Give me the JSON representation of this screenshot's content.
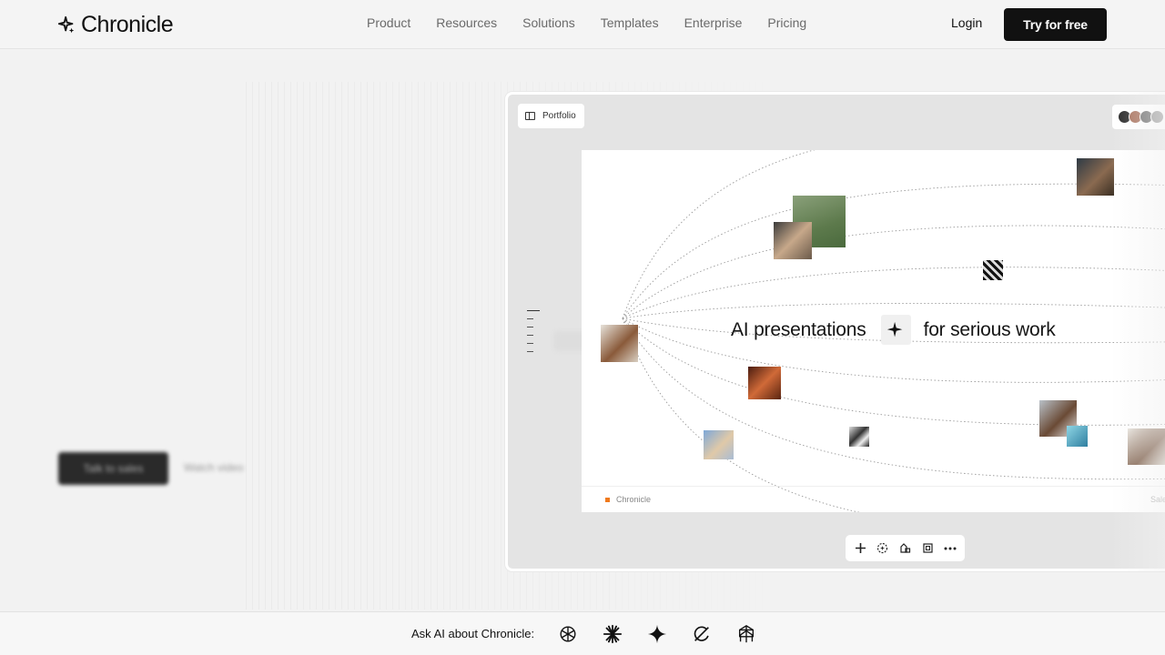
{
  "header": {
    "logo_text": "Chronicle",
    "nav": [
      "Product",
      "Resources",
      "Solutions",
      "Templates",
      "Enterprise",
      "Pricing"
    ],
    "login": "Login",
    "cta": "Try for free"
  },
  "hero": {
    "primary_button": "Talk to sales",
    "secondary_link": "Watch video"
  },
  "window": {
    "tab_label": "Portfolio",
    "slide": {
      "headline_left": "AI presentations",
      "headline_right": "for serious work",
      "footer_brand": "Chronicle",
      "footer_right": "Sale"
    },
    "toolbar_icons": [
      "plus-icon",
      "sparkle-circle-icon",
      "shapes-icon",
      "frame-icon",
      "more-icon"
    ]
  },
  "bottom": {
    "ask_label": "Ask AI about Chronicle:",
    "ai_icons": [
      "openai-icon",
      "claude-icon",
      "gemini-icon",
      "grok-icon",
      "perplexity-icon"
    ]
  },
  "colors": {
    "accent_orange": "#f07a1d",
    "cta_bg": "#111111"
  }
}
